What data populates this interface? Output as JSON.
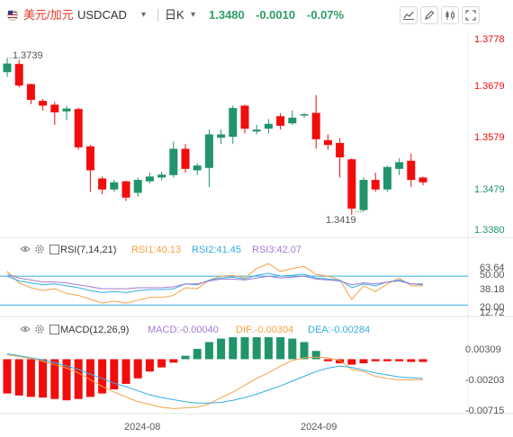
{
  "toolbar": {
    "symbol_name": "美元/加元",
    "symbol_code": "USDCAD",
    "interval": "日K",
    "last_price": "1.3480",
    "change": "-0.0010",
    "change_pct": "-0.07%",
    "icons": [
      "flag-icon",
      "chevron-down-icon",
      "chevron-down-icon",
      "line-chart-icon",
      "pencil-icon",
      "candle-settings-icon",
      "fullscreen-icon"
    ]
  },
  "colors": {
    "up": "#21946a",
    "down": "#f20d0d",
    "positive_text": "#2e9e68"
  },
  "price_panel": {
    "axis_labels": [
      "1.3778",
      "1.3679",
      "1.3579",
      "1.3479",
      "1.3380"
    ],
    "axis_label_colors": [
      "#f20d0d",
      "#f20d0d",
      "#f20d0d",
      "#21946a",
      "#21946a"
    ],
    "high_label": "1.3739",
    "low_label": "1.3419"
  },
  "rsi_panel": {
    "title": "RSI(7,14,21)",
    "rsi1": "RSI1:40.13",
    "rsi2": "RSI2:41.45",
    "rsi3": "RSI3:42.07",
    "axis_labels": [
      "63.64",
      "50.00",
      "38.18",
      "20.00",
      "12.72"
    ]
  },
  "macd_panel": {
    "title": "MACD(12,26,9)",
    "macd": "MACD:-0.00040",
    "dif": "DIF:-0.00304",
    "dea": "DEA:-0.00284",
    "axis_labels": [
      "0.00309",
      "-0.00203",
      "-0.00715"
    ]
  },
  "x_axis": {
    "labels": [
      "2024-08",
      "2024-09"
    ]
  },
  "chart_data": {
    "type": "candlestick",
    "price_range": [
      1.338,
      1.3778
    ],
    "candles": [
      {
        "o": 1.371,
        "h": 1.3739,
        "l": 1.37,
        "c": 1.3728
      },
      {
        "o": 1.3727,
        "h": 1.3735,
        "l": 1.3678,
        "c": 1.3682
      },
      {
        "o": 1.3685,
        "h": 1.3686,
        "l": 1.3643,
        "c": 1.3652
      },
      {
        "o": 1.365,
        "h": 1.3654,
        "l": 1.363,
        "c": 1.364
      },
      {
        "o": 1.3642,
        "h": 1.3648,
        "l": 1.36,
        "c": 1.3626
      },
      {
        "o": 1.3628,
        "h": 1.364,
        "l": 1.361,
        "c": 1.3634
      },
      {
        "o": 1.3633,
        "h": 1.3636,
        "l": 1.3548,
        "c": 1.3553
      },
      {
        "o": 1.3555,
        "h": 1.3558,
        "l": 1.346,
        "c": 1.3505
      },
      {
        "o": 1.3488,
        "h": 1.3492,
        "l": 1.3455,
        "c": 1.3465
      },
      {
        "o": 1.3465,
        "h": 1.3485,
        "l": 1.346,
        "c": 1.348
      },
      {
        "o": 1.3482,
        "h": 1.3483,
        "l": 1.3441,
        "c": 1.3448
      },
      {
        "o": 1.3458,
        "h": 1.349,
        "l": 1.345,
        "c": 1.3485
      },
      {
        "o": 1.3482,
        "h": 1.35,
        "l": 1.3478,
        "c": 1.3492
      },
      {
        "o": 1.349,
        "h": 1.3502,
        "l": 1.3484,
        "c": 1.3496
      },
      {
        "o": 1.3495,
        "h": 1.3565,
        "l": 1.349,
        "c": 1.355
      },
      {
        "o": 1.355,
        "h": 1.356,
        "l": 1.35,
        "c": 1.3508
      },
      {
        "o": 1.3505,
        "h": 1.352,
        "l": 1.3495,
        "c": 1.3515
      },
      {
        "o": 1.351,
        "h": 1.359,
        "l": 1.347,
        "c": 1.358
      },
      {
        "o": 1.3573,
        "h": 1.359,
        "l": 1.356,
        "c": 1.358
      },
      {
        "o": 1.3575,
        "h": 1.364,
        "l": 1.356,
        "c": 1.3635
      },
      {
        "o": 1.364,
        "h": 1.3642,
        "l": 1.3582,
        "c": 1.3592
      },
      {
        "o": 1.3586,
        "h": 1.36,
        "l": 1.358,
        "c": 1.359
      },
      {
        "o": 1.3592,
        "h": 1.3612,
        "l": 1.3582,
        "c": 1.3602
      },
      {
        "o": 1.3618,
        "h": 1.3624,
        "l": 1.359,
        "c": 1.3598
      },
      {
        "o": 1.3603,
        "h": 1.363,
        "l": 1.36,
        "c": 1.3615
      },
      {
        "o": 1.362,
        "h": 1.3625,
        "l": 1.3615,
        "c": 1.3622
      },
      {
        "o": 1.3625,
        "h": 1.3662,
        "l": 1.355,
        "c": 1.357
      },
      {
        "o": 1.3568,
        "h": 1.358,
        "l": 1.3548,
        "c": 1.3558
      },
      {
        "o": 1.3562,
        "h": 1.3572,
        "l": 1.349,
        "c": 1.3532
      },
      {
        "o": 1.3528,
        "h": 1.353,
        "l": 1.3412,
        "c": 1.3425
      },
      {
        "o": 1.3422,
        "h": 1.349,
        "l": 1.3419,
        "c": 1.3485
      },
      {
        "o": 1.3485,
        "h": 1.35,
        "l": 1.346,
        "c": 1.3465
      },
      {
        "o": 1.3465,
        "h": 1.3515,
        "l": 1.346,
        "c": 1.3512
      },
      {
        "o": 1.3508,
        "h": 1.353,
        "l": 1.3495,
        "c": 1.3522
      },
      {
        "o": 1.3525,
        "h": 1.354,
        "l": 1.347,
        "c": 1.3485
      },
      {
        "o": 1.349,
        "h": 1.3492,
        "l": 1.3474,
        "c": 1.348
      }
    ],
    "rsi": {
      "range": [
        10,
        66
      ],
      "series": [
        {
          "name": "RSI1",
          "color": "#f5a142",
          "values": [
            55,
            43,
            38,
            35,
            37,
            32,
            30,
            26,
            22,
            24,
            22,
            25,
            28,
            28,
            30,
            38,
            37,
            46,
            50,
            51,
            48,
            58,
            63,
            55,
            58,
            60,
            52,
            50,
            46,
            26,
            40,
            34,
            42,
            48,
            40,
            40
          ]
        },
        {
          "name": "RSI2",
          "color": "#33aee4",
          "values": [
            50,
            45,
            43,
            41,
            42,
            40,
            38,
            35,
            33,
            34,
            33,
            35,
            36,
            36,
            37,
            42,
            41,
            46,
            48,
            49,
            47,
            51,
            53,
            50,
            51,
            52,
            48,
            47,
            46,
            38,
            42,
            40,
            44,
            46,
            42,
            41
          ]
        },
        {
          "name": "RSI3",
          "color": "#a37bd6",
          "values": [
            52,
            48,
            46,
            44,
            44,
            43,
            41,
            39,
            37,
            37,
            37,
            38,
            38,
            38,
            39,
            42,
            42,
            45,
            47,
            47,
            46,
            48,
            50,
            48,
            49,
            50,
            47,
            46,
            45,
            41,
            43,
            42,
            44,
            45,
            42,
            42
          ]
        }
      ],
      "levels": [
        50.0,
        20.0
      ]
    },
    "macd": {
      "range": [
        -0.0082,
        0.0036
      ],
      "hist": [
        -0.005,
        -0.0053,
        -0.0055,
        -0.0056,
        -0.0058,
        -0.006,
        -0.0058,
        -0.0055,
        -0.005,
        -0.0044,
        -0.0036,
        -0.0028,
        -0.0018,
        -0.0012,
        -0.0005,
        0.0005,
        0.0015,
        0.0025,
        0.003,
        0.0032,
        0.0032,
        0.0032,
        0.0032,
        0.0032,
        0.003,
        0.0025,
        0.0012,
        -0.0003,
        -0.0006,
        -0.0008,
        -0.0006,
        -0.0003,
        -0.0003,
        -0.0003,
        -0.0004,
        -0.0004
      ],
      "dif": [
        0.0006,
        0.0004,
        0.0001,
        -0.0003,
        -0.0008,
        -0.0013,
        -0.002,
        -0.003,
        -0.004,
        -0.0048,
        -0.0055,
        -0.0062,
        -0.0066,
        -0.007,
        -0.0072,
        -0.0071,
        -0.007,
        -0.0065,
        -0.0056,
        -0.0048,
        -0.0038,
        -0.0028,
        -0.002,
        -0.001,
        -0.0002,
        0.0002,
        0.0003,
        0.0002,
        -0.0002,
        -0.0015,
        -0.0018,
        -0.0025,
        -0.0028,
        -0.003,
        -0.003,
        -0.003
      ],
      "dea": [
        0.0008,
        0.0005,
        0.0002,
        -0.0001,
        -0.0005,
        -0.001,
        -0.0015,
        -0.0022,
        -0.0028,
        -0.0035,
        -0.004,
        -0.0046,
        -0.0052,
        -0.0056,
        -0.0059,
        -0.0062,
        -0.0064,
        -0.0064,
        -0.0063,
        -0.006,
        -0.0056,
        -0.0051,
        -0.0045,
        -0.0039,
        -0.0032,
        -0.0025,
        -0.0018,
        -0.0013,
        -0.001,
        -0.0012,
        -0.0016,
        -0.002,
        -0.0023,
        -0.0026,
        -0.0027,
        -0.0028
      ],
      "dif_color": "#f5a142",
      "dea_color": "#33aee4"
    }
  }
}
